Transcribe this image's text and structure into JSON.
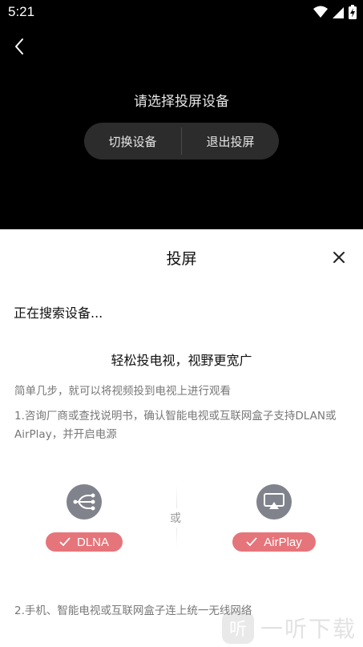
{
  "status_bar": {
    "time": "5:21",
    "icons": [
      "wifi-icon",
      "signal-icon",
      "battery-charging-icon"
    ]
  },
  "header": {
    "prompt": "请选择投屏设备",
    "switch_device_label": "切换设备",
    "exit_cast_label": "退出投屏"
  },
  "sheet": {
    "title": "投屏",
    "searching_text": "正在搜索设备...",
    "headline": "轻松投电视，视野更宽广",
    "subtext": "简单几步，就可以将视频投到电视上进行观看",
    "step1": "1.咨询厂商或查找说明书，确认智能电视或互联网盒子支持DLAN或AirPlay，并开启电源",
    "or_label": "或",
    "dlna_label": "DLNA",
    "airplay_label": "AirPlay",
    "step2": "2.手机、智能电视或互联网盒子连上统一无线网络"
  },
  "watermark": {
    "icon_char": "听",
    "text": "一听下载"
  },
  "colors": {
    "badge": "#e5757a",
    "icon_circle": "#80838c",
    "pill": "#2c2c2c"
  }
}
